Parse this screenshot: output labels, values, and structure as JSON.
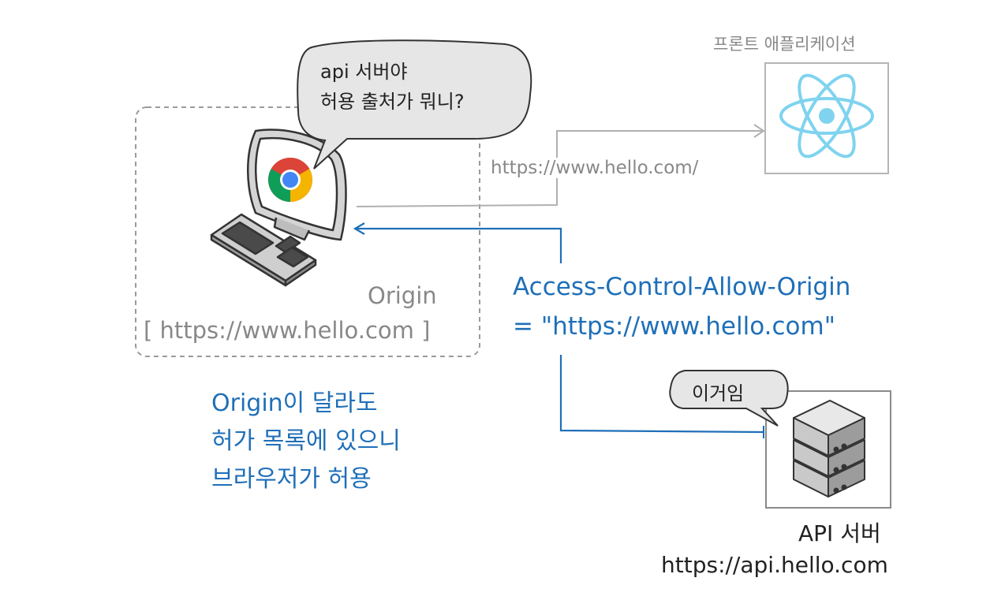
{
  "client": {
    "speech": {
      "line1": "api 서버야",
      "line2": "허용 출처가 뭐니?"
    },
    "origin_title": "Origin",
    "origin_value": "[ https://www.hello.com ]"
  },
  "frontend": {
    "title": "프론트 애플리케이션",
    "url": "https://www.hello.com/"
  },
  "response": {
    "header_line1": "Access-Control-Allow-Origin",
    "header_line2": "= \"https://www.hello.com\""
  },
  "explanation": {
    "line1": "Origin이 달라도",
    "line2": "허가 목록에 있으니",
    "line3": "브라우저가 허용"
  },
  "api_server": {
    "speech": "이거임",
    "title": "API 서버",
    "url": "https://api.hello.com"
  },
  "colors": {
    "accent": "#1f6fb8",
    "muted": "#888888",
    "react": "#7fd3ef",
    "chrome_red": "#db4437",
    "chrome_green": "#0f9d58",
    "chrome_yellow": "#f4b400",
    "chrome_blue": "#4285f4"
  },
  "icons": [
    "chrome-icon",
    "react-icon",
    "server-icon",
    "keyboard-icon",
    "monitor-icon"
  ]
}
